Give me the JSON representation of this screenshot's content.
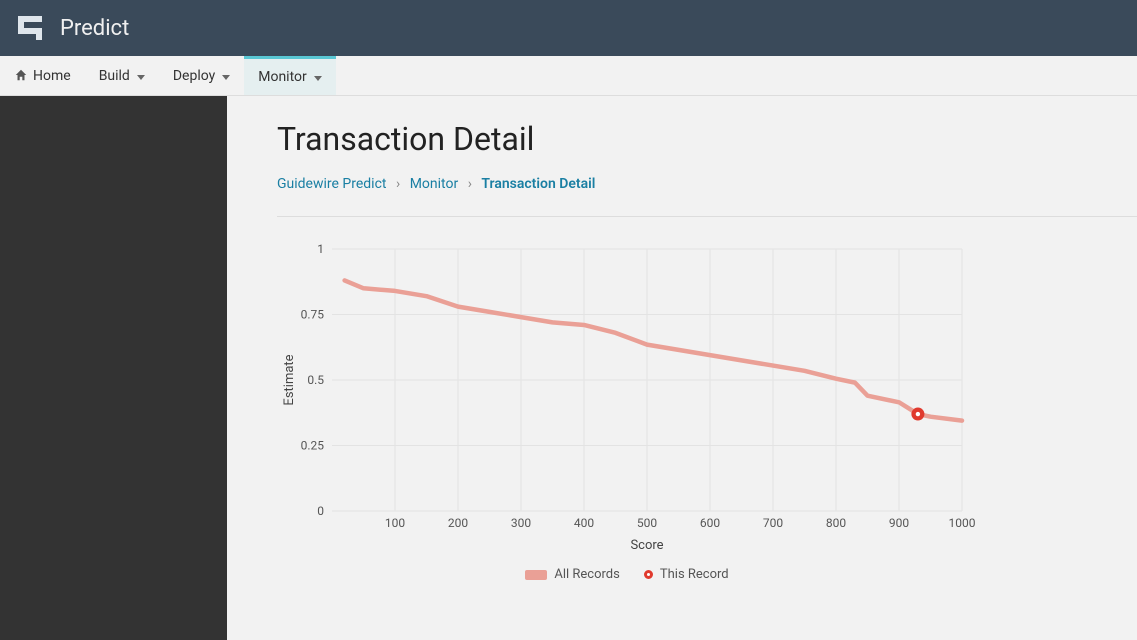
{
  "brand": "Predict",
  "menu": {
    "home": "Home",
    "build": "Build",
    "deploy": "Deploy",
    "monitor": "Monitor"
  },
  "page_title": "Transaction Detail",
  "breadcrumb": {
    "a": "Guidewire Predict",
    "b": "Monitor",
    "c": "Transaction Detail"
  },
  "chart": {
    "xlabel": "Score",
    "ylabel": "Estimate",
    "legend_all": "All Records",
    "legend_this": "This Record"
  },
  "chart_data": {
    "type": "line",
    "title": "",
    "xlabel": "Score",
    "ylabel": "Estimate",
    "xlim": [
      0,
      1000
    ],
    "ylim": [
      0,
      1
    ],
    "x_ticks": [
      100,
      200,
      300,
      400,
      500,
      600,
      700,
      800,
      900,
      1000
    ],
    "y_ticks": [
      0,
      0.25,
      0.5,
      0.75,
      1
    ],
    "series": [
      {
        "name": "All Records",
        "x": [
          20,
          50,
          100,
          150,
          200,
          250,
          300,
          350,
          400,
          450,
          500,
          550,
          600,
          650,
          700,
          750,
          800,
          830,
          850,
          900,
          930,
          950,
          1000
        ],
        "values": [
          0.88,
          0.85,
          0.84,
          0.82,
          0.78,
          0.76,
          0.74,
          0.72,
          0.71,
          0.68,
          0.635,
          0.615,
          0.595,
          0.575,
          0.555,
          0.535,
          0.505,
          0.49,
          0.44,
          0.415,
          0.37,
          0.36,
          0.345
        ]
      }
    ],
    "this_record": {
      "name": "This Record",
      "x": 930,
      "y": 0.37
    }
  }
}
